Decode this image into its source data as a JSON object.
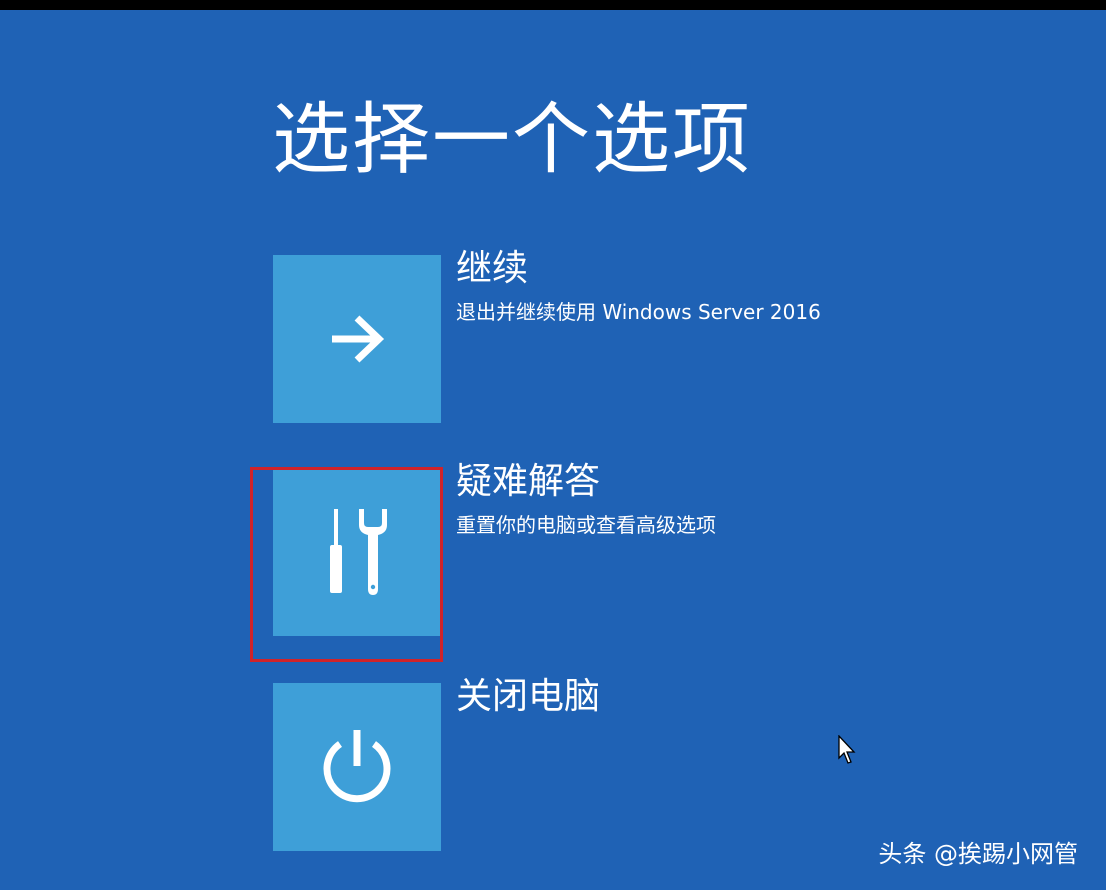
{
  "screen": {
    "title": "选择一个选项",
    "background_color": "#1f62b5",
    "tile_color": "#3e9fd8",
    "highlight_color": "#d0232a"
  },
  "options": [
    {
      "label": "继续",
      "description": "退出并继续使用 Windows Server 2016",
      "icon": "arrow-right-icon"
    },
    {
      "label": "疑难解答",
      "description": "重置你的电脑或查看高级选项",
      "icon": "tools-icon",
      "highlighted": true
    },
    {
      "label": "关闭电脑",
      "description": "",
      "icon": "power-icon"
    }
  ],
  "watermark": {
    "text": "头条 @挨踢小网管"
  }
}
